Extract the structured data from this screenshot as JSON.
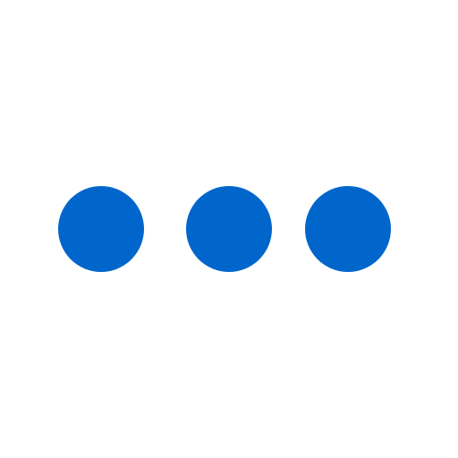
{
  "icon": {
    "name": "more-horizontal-icon",
    "dot_color": "#0066CC",
    "background_color": "#FFFFFF",
    "dot_count": 3
  }
}
